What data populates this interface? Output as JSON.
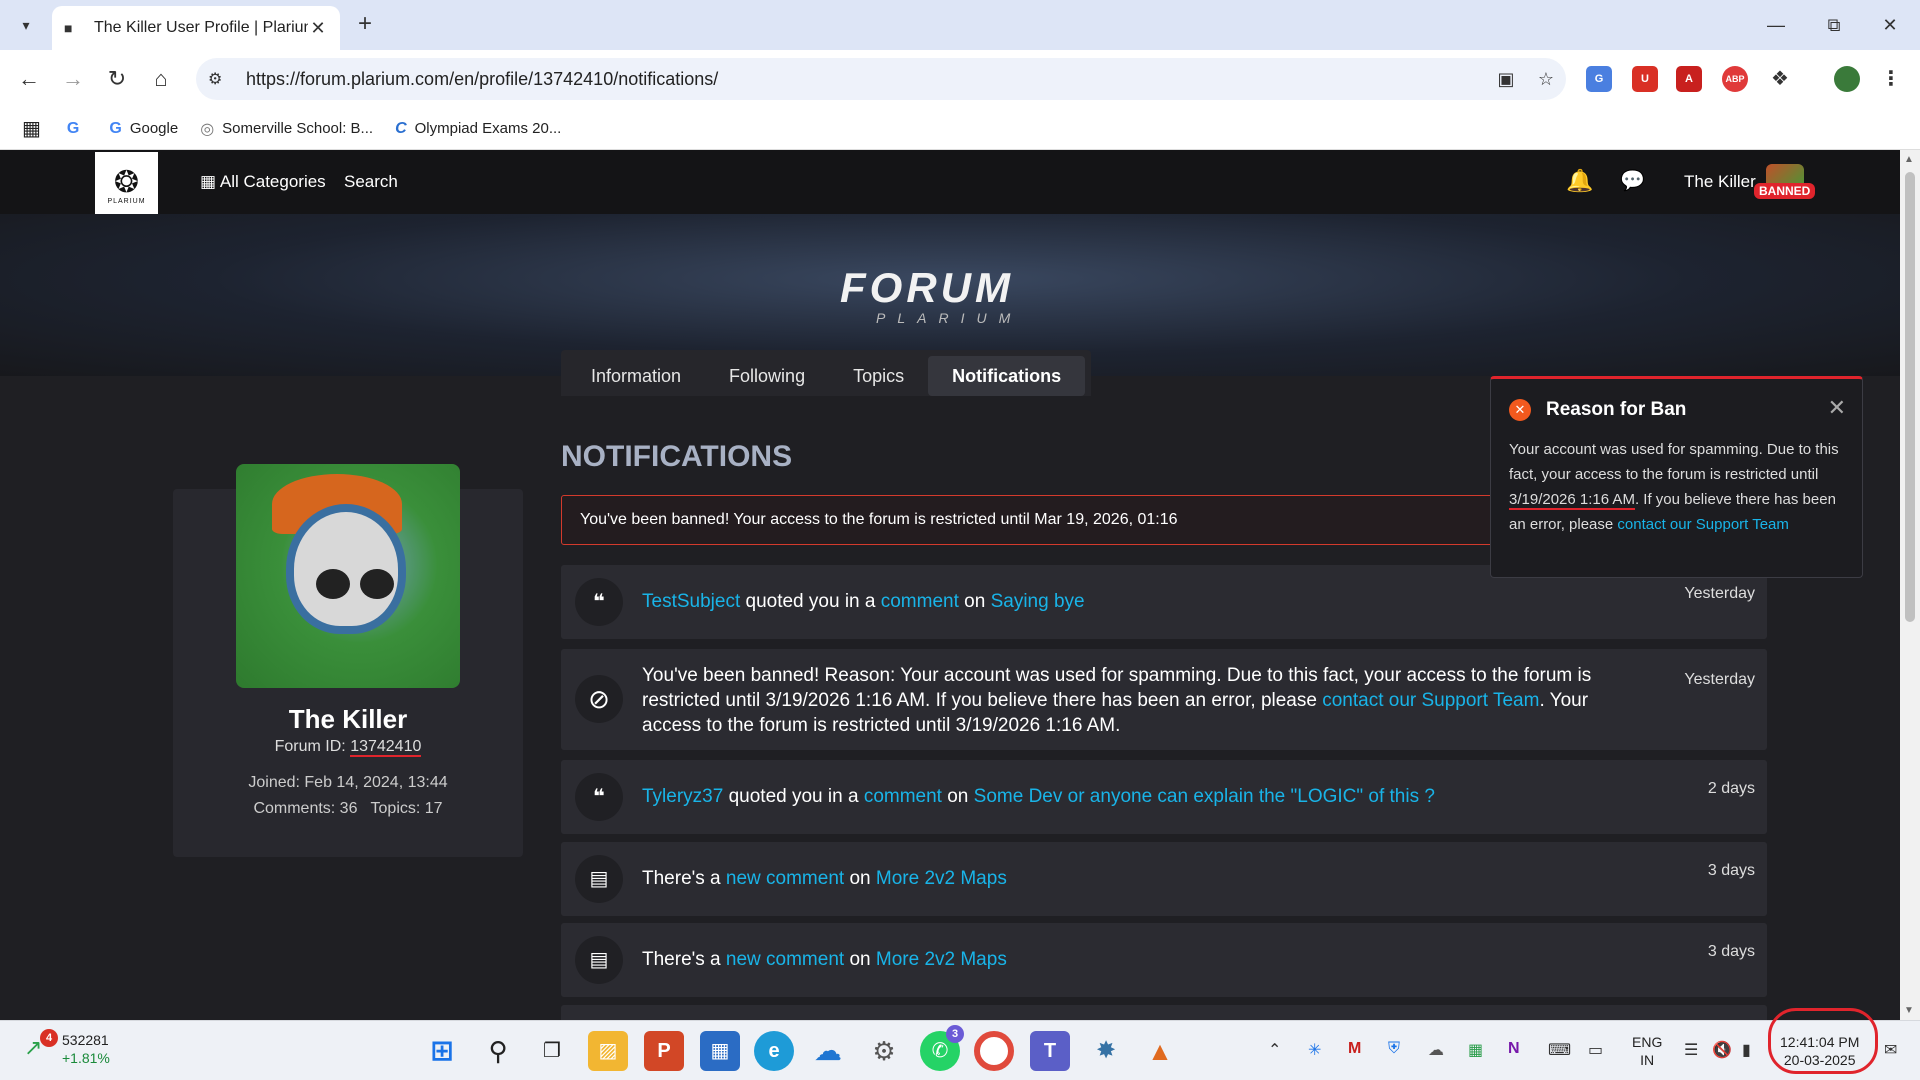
{
  "browser": {
    "tab_title": "The Killer User Profile | Plarium",
    "url": "https://forum.plarium.com/en/profile/13742410/notifications/",
    "bookmarks": [
      {
        "label": "",
        "icon": "G"
      },
      {
        "label": "Google",
        "icon": "G"
      },
      {
        "label": "Somerville School: B...",
        "icon": "◎"
      },
      {
        "label": "Olympiad Exams 20...",
        "icon": "C"
      }
    ],
    "extensions": [
      {
        "name": "translate-extension",
        "label": "G",
        "color": "#4a7fe0"
      },
      {
        "name": "shield-extension",
        "label": "U",
        "color": "#d93025"
      },
      {
        "name": "pdf-extension",
        "label": "A",
        "color": "#c8201e"
      },
      {
        "name": "adblock-extension",
        "label": "ABP",
        "color": "#e03a3a"
      }
    ]
  },
  "site_nav": {
    "logo_text": "PLARIUM",
    "all_categories": "All Categories",
    "search": "Search",
    "user_name": "The Killer",
    "banned_badge": "BANNED"
  },
  "hero": {
    "title": "FORUM",
    "subtitle": "PLARIUM"
  },
  "profile_tabs": [
    {
      "label": "Information",
      "active": false
    },
    {
      "label": "Following",
      "active": false
    },
    {
      "label": "Topics",
      "active": false
    },
    {
      "label": "Notifications",
      "active": true
    }
  ],
  "profile": {
    "name": "The Killer",
    "forum_id_label": "Forum ID:",
    "forum_id": "13742410",
    "joined": "Joined: Feb 14, 2024, 13:44",
    "counts": "Comments: 36   Topics: 17"
  },
  "notifications": {
    "heading": "NOTIFICATIONS",
    "ban_alert": "You've been banned! Your access to the forum is restricted until Mar 19, 2026, 01:16",
    "items": [
      {
        "icon": "quote-icon",
        "user": "TestSubject",
        "p1": " quoted you in a ",
        "link1": "comment",
        "p2": " on ",
        "link2": "Saying bye",
        "time": "Yesterday"
      },
      {
        "icon": "ban-icon",
        "p1": "You've been banned! Reason: Your account was used for spamming. Due to this fact, your access to the forum is restricted until 3/19/2026 1:16 AM. If you believe there has been an error, please ",
        "link1": "contact our Support Team",
        "p2": ". Your access to the forum is restricted until 3/19/2026 1:16 AM.",
        "time": "Yesterday"
      },
      {
        "icon": "quote-icon",
        "user": "Tyleryz37",
        "p1": " quoted you in a ",
        "link1": "comment",
        "p2": " on ",
        "link2": "Some Dev or anyone can explain the \"LOGIC\" of this ?",
        "time": "2 days"
      },
      {
        "icon": "comment-icon",
        "p1": "There's a ",
        "link1": "new comment",
        "p2": " on ",
        "link2": "More 2v2 Maps",
        "time": "3 days"
      },
      {
        "icon": "comment-icon",
        "p1": "There's a ",
        "link1": "new comment",
        "p2": " on ",
        "link2": "More 2v2 Maps",
        "time": "3 days"
      }
    ]
  },
  "ban_popup": {
    "title": "Reason for Ban",
    "body1": "Your account was used for spamming. Due to this fact, your access to the forum is restricted until ",
    "date": "3/19/2026 1:16 AM",
    "body2": ". If you believe there has been an error, please ",
    "link": "contact our Support Team"
  },
  "taskbar": {
    "stock_badge": "4",
    "stock_value": "532281",
    "stock_change": "+1.81%",
    "whatsapp_badge": "3",
    "lang_line1": "ENG",
    "lang_line2": "IN",
    "time": "12:41:04 PM",
    "date": "20-03-2025"
  },
  "colors": {
    "link": "#19b4e8",
    "banned": "#e0242c",
    "page_bg": "#1f1f23",
    "card_bg": "#2b2b31"
  }
}
